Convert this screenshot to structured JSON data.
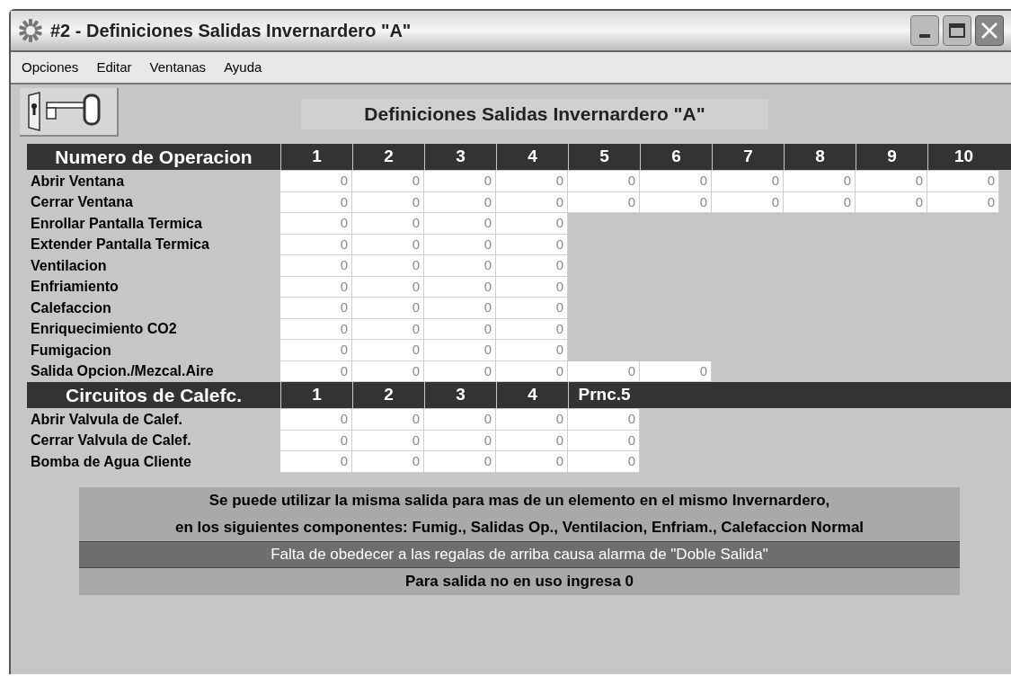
{
  "window": {
    "title": "#2  - Definiciones Salidas Invernardero \"A\""
  },
  "menu": [
    "Opciones",
    "Editar",
    "Ventanas",
    "Ayuda"
  ],
  "banner": "Definiciones Salidas Invernardero \"A\"",
  "sections": [
    {
      "heading": "Numero de Operacion",
      "columns": [
        "1",
        "2",
        "3",
        "4",
        "5",
        "6",
        "7",
        "8",
        "9",
        "10"
      ],
      "rows": [
        {
          "label": "Abrir Ventana",
          "values": [
            "0",
            "0",
            "0",
            "0",
            "0",
            "0",
            "0",
            "0",
            "0",
            "0"
          ]
        },
        {
          "label": "Cerrar Ventana",
          "values": [
            "0",
            "0",
            "0",
            "0",
            "0",
            "0",
            "0",
            "0",
            "0",
            "0"
          ]
        },
        {
          "label": "Enrollar Pantalla Termica",
          "values": [
            "0",
            "0",
            "0",
            "0"
          ]
        },
        {
          "label": "Extender Pantalla Termica",
          "values": [
            "0",
            "0",
            "0",
            "0"
          ]
        },
        {
          "label": "Ventilacion",
          "values": [
            "0",
            "0",
            "0",
            "0"
          ]
        },
        {
          "label": "Enfriamiento",
          "values": [
            "0",
            "0",
            "0",
            "0"
          ]
        },
        {
          "label": "Calefaccion",
          "values": [
            "0",
            "0",
            "0",
            "0"
          ]
        },
        {
          "label": "Enriquecimiento CO2",
          "values": [
            "0",
            "0",
            "0",
            "0"
          ]
        },
        {
          "label": "Fumigacion",
          "values": [
            "0",
            "0",
            "0",
            "0"
          ]
        },
        {
          "label": "Salida Opcion./Mezcal.Aire",
          "values": [
            "0",
            "0",
            "0",
            "0",
            "0",
            "0"
          ]
        }
      ]
    },
    {
      "heading": "Circuitos de Calefc.",
      "columns": [
        "1",
        "2",
        "3",
        "4",
        "Prnc.5"
      ],
      "rows": [
        {
          "label": "Abrir Valvula de Calef.",
          "values": [
            "0",
            "0",
            "0",
            "0",
            "0"
          ]
        },
        {
          "label": "Cerrar Valvula de Calef.",
          "values": [
            "0",
            "0",
            "0",
            "0",
            "0"
          ]
        },
        {
          "label": "Bomba de Agua Cliente",
          "values": [
            "0",
            "0",
            "0",
            "0",
            "0"
          ]
        }
      ]
    }
  ],
  "notes": [
    {
      "kind": "plain",
      "text": "Se puede utilizar la misma salida para mas de un elemento en el mismo Invernardero,"
    },
    {
      "kind": "plain",
      "text": "en los siguientes componentes: Fumig., Salidas Op., Ventilacion, Enfriam., Calefaccion Normal"
    },
    {
      "kind": "warning",
      "text": "Falta de obedecer a las regalas de arriba causa alarma de \"Doble Salida\""
    },
    {
      "kind": "plain",
      "text": "Para salida no en uso ingresa 0"
    }
  ]
}
